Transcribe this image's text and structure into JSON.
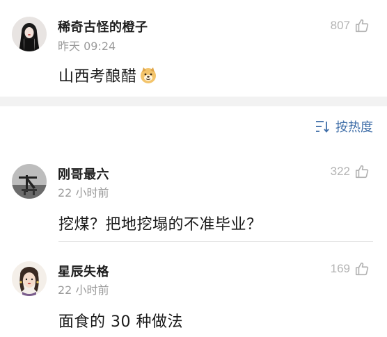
{
  "comments_top": {
    "username": "稀奇古怪的橙子",
    "timestamp": "昨天 09:24",
    "text": "山西考酿醋",
    "emoji": "dog-face-emoji",
    "likes": "807"
  },
  "sort": {
    "label": "按热度",
    "icon": "sort-icon"
  },
  "comments": [
    {
      "username": "刚哥最六",
      "timestamp": "22 小时前",
      "text": "挖煤？把地挖塌的不准毕业？",
      "likes": "322"
    },
    {
      "username": "星辰失格",
      "timestamp": "22 小时前",
      "text": "面食的 30 种做法",
      "likes": "169"
    }
  ],
  "colors": {
    "accent": "#3f6ea8",
    "muted": "#9a9a9a",
    "separator": "#f2f2f2"
  }
}
